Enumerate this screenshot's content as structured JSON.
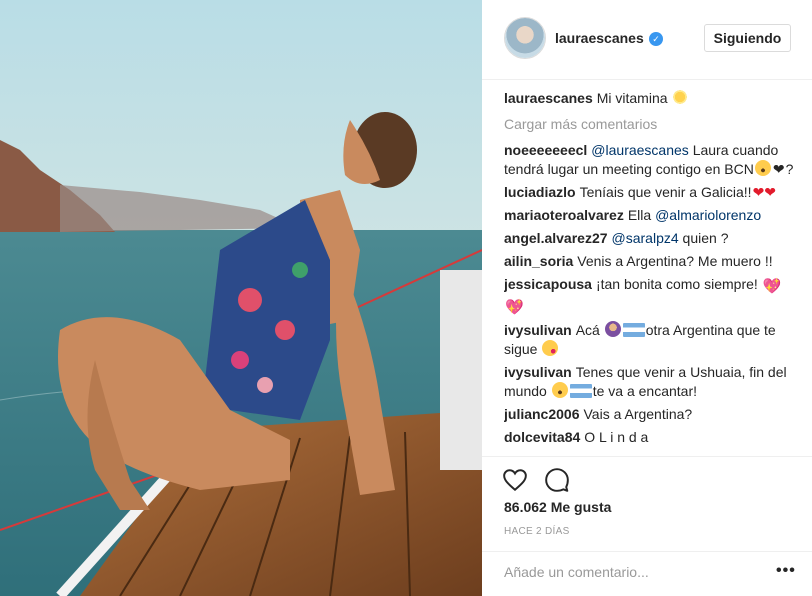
{
  "post": {
    "username": "lauraescanes",
    "follow_label": "Siguiendo",
    "caption_user": "lauraescanes",
    "caption_text": "Mi vitamina",
    "load_more": "Cargar más comentarios",
    "likes": "86.062 Me gusta",
    "time_ago": "HACE 2 DÍAS",
    "add_comment_placeholder": "Añade un comentario...",
    "more_options": "•••"
  },
  "comments": [
    {
      "user": "noeeeeeeecl",
      "mention": "@lauraescanes",
      "text": "Laura cuando tendrá lugar un meeting contigo en BCN"
    },
    {
      "user": "luciadiazlo",
      "text": "Teníais que venir a Galicia!!"
    },
    {
      "user": "mariaoteroalvarez",
      "text": "Ella",
      "mention": "@almariolorenzo"
    },
    {
      "user": "angel.alvarez27",
      "mention": "@saralpz4",
      "text": "quien ?"
    },
    {
      "user": "ailin_soria",
      "text": "Venis a Argentina? Me muero !!"
    },
    {
      "user": "jessicapousa",
      "text": "¡tan bonita como siempre!"
    },
    {
      "user": "ivysulivan",
      "text_a": "Acá",
      "text_b": "otra Argentina que te sigue"
    },
    {
      "user": "ivysulivan",
      "text_a": "Tenes que venir a Ushuaia, fin del mundo",
      "text_b": "te va a encantar!"
    },
    {
      "user": "julianc2006",
      "text": "Vais a Argentina?"
    },
    {
      "user": "dolcevita84",
      "text": "O L i n d a"
    }
  ],
  "colors": {
    "text": "#262626",
    "muted": "#999999",
    "mention": "#003569",
    "verified": "#3897f0",
    "border": "#efefef"
  },
  "icons": [
    "verified-badge-icon",
    "heart-icon",
    "comment-icon",
    "more-options-icon"
  ]
}
